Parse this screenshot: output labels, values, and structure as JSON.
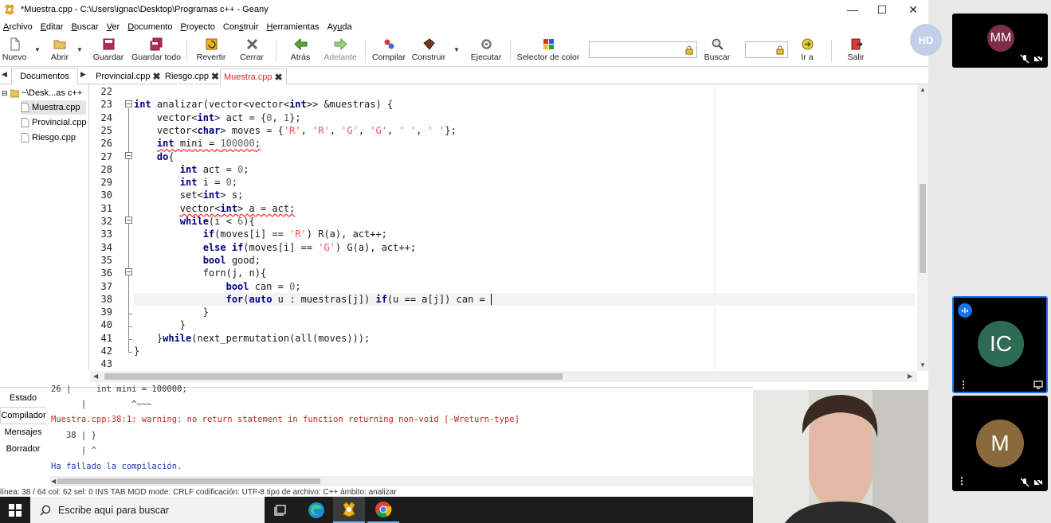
{
  "window": {
    "title": "*Muestra.cpp - C:\\Users\\ignac\\Desktop\\Programas c++ - Geany",
    "controls": {
      "minimize": "—",
      "maximize": "☐",
      "close": "✕"
    }
  },
  "menu": [
    {
      "underline": "A",
      "rest": "rchivo"
    },
    {
      "underline": "E",
      "rest": "ditar"
    },
    {
      "underline": "B",
      "rest": "uscar"
    },
    {
      "underline": "V",
      "rest": "er"
    },
    {
      "underline": "D",
      "rest": "ocumento"
    },
    {
      "underline": "P",
      "rest": "royecto"
    },
    {
      "pre": "Con",
      "underline": "s",
      "rest": "truir"
    },
    {
      "underline": "H",
      "rest": "erramientas"
    },
    {
      "pre": "Ay",
      "underline": "u",
      "rest": "da"
    }
  ],
  "toolbar": {
    "nuevo": "Nuevo",
    "abrir": "Abrir",
    "guardar": "Guardar",
    "guardar_todo": "Guardar todo",
    "revertir": "Revertir",
    "cerrar": "Cerrar",
    "atras": "Atrás",
    "adelante": "Adelante",
    "compilar": "Compilar",
    "construir": "Construir",
    "ejecutar": "Ejecutar",
    "selector_color": "Selector de color",
    "buscar": "Buscar",
    "ir_a": "Ir a",
    "salir": "Salir"
  },
  "sidebar": {
    "tab": "Documentos",
    "folder": "~\\Desk...as c++",
    "files": [
      "Muestra.cpp",
      "Provincial.cpp",
      "Riesgo.cpp"
    ]
  },
  "tabs": [
    "Provincial.cpp",
    "Riesgo.cpp",
    "Muestra.cpp"
  ],
  "editor": {
    "line_numbers": [
      "22",
      "23",
      "24",
      "25",
      "26",
      "27",
      "28",
      "29",
      "30",
      "31",
      "32",
      "33",
      "34",
      "35",
      "36",
      "37",
      "38",
      "39",
      "40",
      "41",
      "42",
      "43"
    ],
    "lines": [
      "",
      "int analizar(vector<vector<int>> &muestras) {",
      "    vector<int> act = {0, 1};",
      "    vector<char> moves = {'R', 'R', 'G', 'G', ' ', ' '};",
      "    int mini = 100000;",
      "    do{",
      "        int act = 0;",
      "        int i = 0;",
      "        set<int> s;",
      "        vector<int> a = act;",
      "        while(i < 6){",
      "            if(moves[i] == 'R') R(a), act++;",
      "            else if(moves[i] == 'G') G(a), act++;",
      "            bool good;",
      "            forn(j, n){",
      "                bool can = 0;",
      "                for(auto u : muestras[j]) if(u == a[j]) can = ",
      "            }",
      "        }",
      "    }while(next_permutation(all(moves)));",
      "}",
      ""
    ]
  },
  "messages": {
    "tabs": [
      "Estado",
      "Compilador",
      "Mensajes",
      "Borrador"
    ],
    "lines": [
      "26 |     int mini = 100000;",
      "      |         ^~~~",
      "Muestra.cpp:38:1: warning: no return statement in function returning non-void [-Wreturn-type]",
      "   38 | }",
      "      | ^",
      "Ha fallado la compilación."
    ]
  },
  "statusbar": "línea: 38 / 64    col: 62    sel: 0     INS     TAB     MOD     mode: CRLF     codificación: UTF-8     tipo de archivo: C++     ámbito: analizar",
  "taskbar": {
    "search_placeholder": "Escribe aquí para buscar"
  },
  "meet": {
    "participants": [
      {
        "initials": "MM",
        "color": "#7b2d4a"
      },
      {
        "initials": "IC",
        "color": "#2e6b55"
      },
      {
        "initials": "M",
        "color": "#8a6a3c"
      }
    ],
    "self_initials": "HD"
  }
}
